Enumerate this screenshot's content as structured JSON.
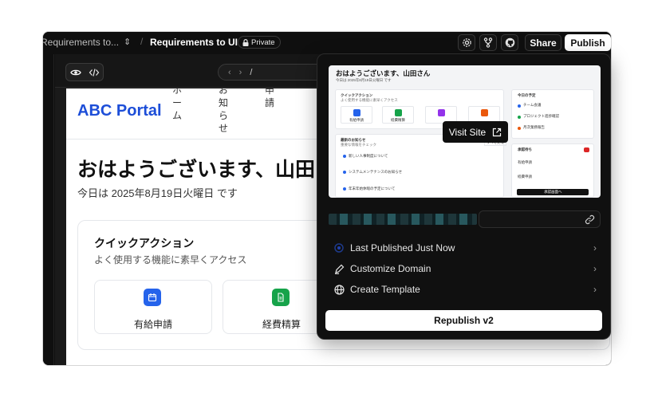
{
  "topbar": {
    "project_crumb": "Requirements to...",
    "page_title": "Requirements to UI",
    "private_label": "Private",
    "share_label": "Share",
    "publish_label": "Publish"
  },
  "preview_bar": {
    "url_path": "/"
  },
  "site": {
    "brand": "ABC Portal",
    "nav_items": [
      "ホーム",
      "お知らせ",
      "申請"
    ],
    "greeting": "おはようございます、山田さん",
    "date_line": "今日は 2025年8月19日火曜日 です",
    "quick_actions": {
      "title": "クイックアクション",
      "subtitle": "よく使用する機能に素早くアクセス",
      "items": [
        {
          "label": "有給申請",
          "color": "#2563eb",
          "icon": "calendar-icon"
        },
        {
          "label": "経費精算",
          "color": "#16a34a",
          "icon": "receipt-icon"
        }
      ]
    }
  },
  "popover": {
    "thumbnail": {
      "title": "おはようございます、山田さん",
      "date": "今日は 2025年8月19日火曜日 です",
      "quick_title": "クイックアクション",
      "quick_sub": "よく使用する機能に素早くアクセス",
      "quick_items": [
        "有給申請",
        "経費精算",
        "",
        ""
      ],
      "news_title": "最新のお知らせ",
      "news_sub": "重要な情報をチェック",
      "news_all": "すべて見る",
      "news_items": [
        "新しい人事制度について",
        "システムメンテナンスのお知らせ",
        "年末年始休暇の予定について"
      ],
      "schedule_title": "今日の予定",
      "schedule_items": [
        "チーム会議",
        "プロジェクト進捗確認",
        "月次業務報告"
      ],
      "approval_title": "承認待ち",
      "approval_items": [
        "有給申請",
        "経費申請"
      ],
      "approval_button": "承認画面へ"
    },
    "visit_label": "Visit Site",
    "menu": [
      {
        "label": "Last Published Just Now",
        "icon": "status-dot-icon"
      },
      {
        "label": "Customize Domain",
        "icon": "pen-icon"
      },
      {
        "label": "Create Template",
        "icon": "globe-icon"
      }
    ],
    "republish_label": "Republish v2"
  }
}
